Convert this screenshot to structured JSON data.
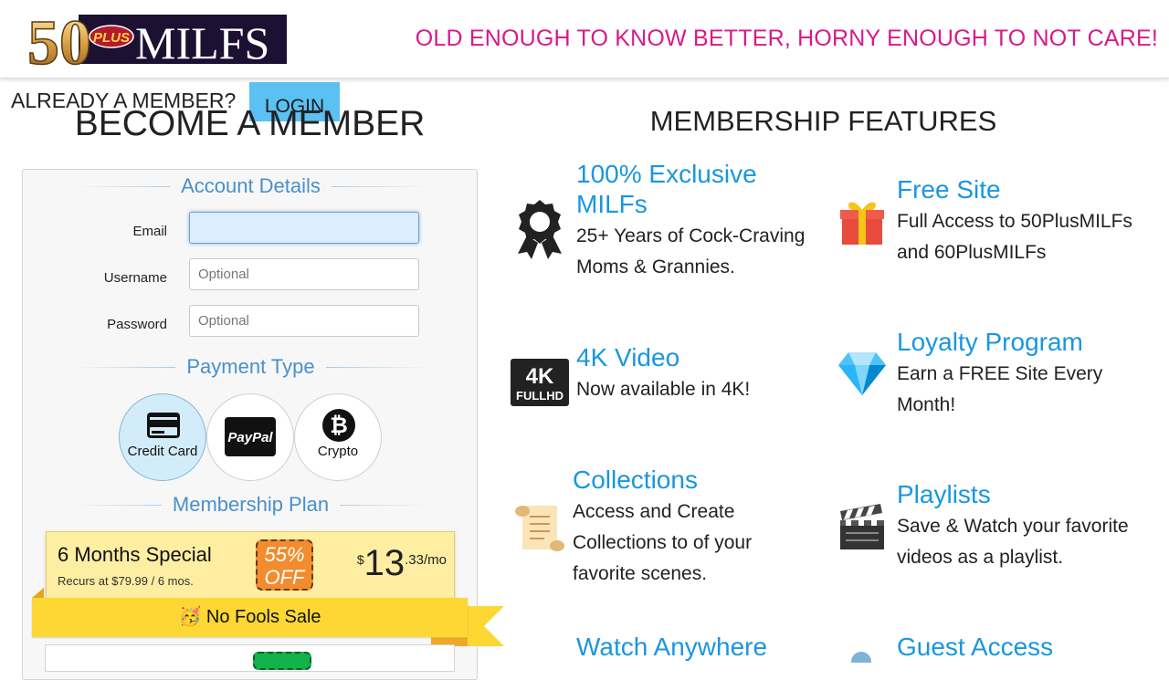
{
  "header": {
    "logo_text_number": "50",
    "logo_text_plus": "PLUS",
    "logo_text_brand": "MILFS",
    "tagline": "OLD ENOUGH TO KNOW BETTER, HORNY ENOUGH TO NOT CARE!"
  },
  "member_bar": {
    "prompt": "ALREADY A MEMBER?",
    "login_label": "LOGIN"
  },
  "signup": {
    "title": "BECOME A MEMBER",
    "account_legend": "Account Details",
    "fields": {
      "email_label": "Email",
      "email_value": "",
      "username_label": "Username",
      "username_placeholder": "Optional",
      "password_label": "Password",
      "password_placeholder": "Optional"
    },
    "payment_legend": "Payment Type",
    "payment_options": {
      "card": "Credit Card",
      "paypal": "PayPal",
      "crypto": "Crypto",
      "selected": "Credit Card"
    },
    "plan_legend": "Membership Plan",
    "plan": {
      "name": "6 Months Special",
      "recurs": "Recurs at $79.99 / 6 mos.",
      "discount_pct": "55%",
      "discount_word": "OFF",
      "currency": "$",
      "price_whole": "13",
      "price_cents": ".33/mo"
    },
    "sale_banner": "🥳 No Fools Sale"
  },
  "features": {
    "title": "MEMBERSHIP FEATURES",
    "items": [
      {
        "title": "100% Exclusive MILFs",
        "desc": "25+ Years of Cock-Craving Moms & Grannies.",
        "icon": "award-icon"
      },
      {
        "title": "Free Site",
        "desc": "Full Access to 50PlusMILFs and 60PlusMILFs",
        "icon": "gift-icon"
      },
      {
        "title": "4K Video",
        "desc": "Now available in 4K!",
        "icon": "4k-fullhd-icon"
      },
      {
        "title": "Loyalty Program",
        "desc": "Earn a FREE Site Every Month!",
        "icon": "diamond-icon"
      },
      {
        "title": "Collections",
        "desc": "Access and Create Collections to of your favorite scenes.",
        "icon": "scroll-icon"
      },
      {
        "title": "Playlists",
        "desc": "Save & Watch your favorite videos as a playlist.",
        "icon": "clapperboard-icon"
      },
      {
        "title": "Watch Anywhere",
        "desc": "",
        "icon": ""
      },
      {
        "title": "Guest Access",
        "desc": "",
        "icon": ""
      }
    ]
  },
  "colors": {
    "tagline": "#d8198c",
    "feature_title": "#1a96e0",
    "legend": "#4a90c9",
    "login_button": "#5bc0f2",
    "plan_background": "#fdeea2",
    "banner": "#fdd835",
    "discount_badge": "#f28c2e"
  }
}
